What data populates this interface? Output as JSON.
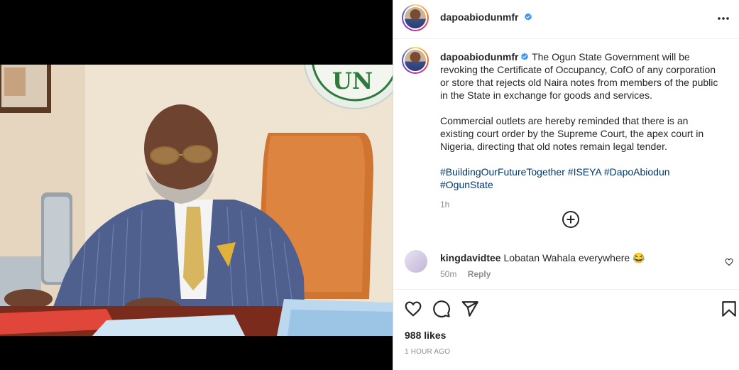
{
  "post": {
    "author": "dapoabiodunmfr",
    "caption_p1": "The Ogun State Government will be revoking the Certificate of Occupancy, CofO of any corporation or store that rejects old Naira notes from members of the public in the State in exchange for goods and services.",
    "caption_p2": "Commercial outlets are hereby reminded that there is an existing court order by the Supreme Court, the apex court in Nigeria, directing that old notes remain legal tender.",
    "hashtags": [
      "#BuildingOurFutureTogether",
      "#ISEYA",
      "#DapoAbiodun",
      "#OgunState"
    ],
    "caption_age": "1h",
    "likes": "988 likes",
    "posted_ago": "1 HOUR AGO",
    "seal_text": "UN"
  },
  "comments": [
    {
      "author": "kingdavidtee",
      "text": "Lobatan Wahala everywhere 😂",
      "age": "50m",
      "reply_label": "Reply"
    }
  ],
  "icons": {
    "verified": "verified-badge-icon",
    "more": "more-options-icon",
    "load_more": "plus-circle-icon",
    "like": "heart-icon",
    "comment": "comment-bubble-icon",
    "share": "paper-plane-icon",
    "save": "bookmark-icon",
    "comment_like": "small-heart-icon"
  },
  "colors": {
    "verified_blue": "#3897f0",
    "hashtag": "#00376b",
    "muted": "#8e8e8e",
    "text": "#262626"
  }
}
